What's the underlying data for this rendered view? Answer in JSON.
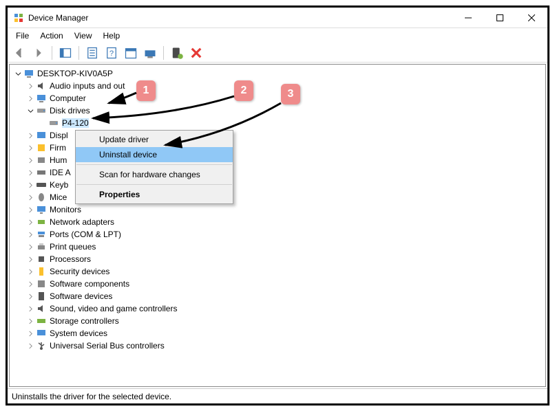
{
  "window": {
    "title": "Device Manager"
  },
  "menubar": {
    "file": "File",
    "action": "Action",
    "view": "View",
    "help": "Help"
  },
  "tree": {
    "root": "DESKTOP-KIV0A5P",
    "audio": "Audio inputs and out",
    "computer": "Computer",
    "diskdrives": "Disk drives",
    "p4120": "P4-120",
    "displ": "Displ",
    "firm": "Firm",
    "hum": "Hum",
    "idea": "IDE A",
    "keyb": "Keyb",
    "mice": "Mice",
    "monitors": "Monitors",
    "network": "Network adapters",
    "ports": "Ports (COM & LPT)",
    "printq": "Print queues",
    "processors": "Processors",
    "security": "Security devices",
    "swcomp": "Software components",
    "swdev": "Software devices",
    "sound": "Sound, video and game controllers",
    "storage": "Storage controllers",
    "system": "System devices",
    "usb": "Universal Serial Bus controllers"
  },
  "context_menu": {
    "update": "Update driver",
    "uninstall": "Uninstall device",
    "scan": "Scan for hardware changes",
    "properties": "Properties"
  },
  "statusbar": "Uninstalls the driver for the selected device.",
  "balloons": {
    "b1": "1",
    "b2": "2",
    "b3": "3"
  }
}
